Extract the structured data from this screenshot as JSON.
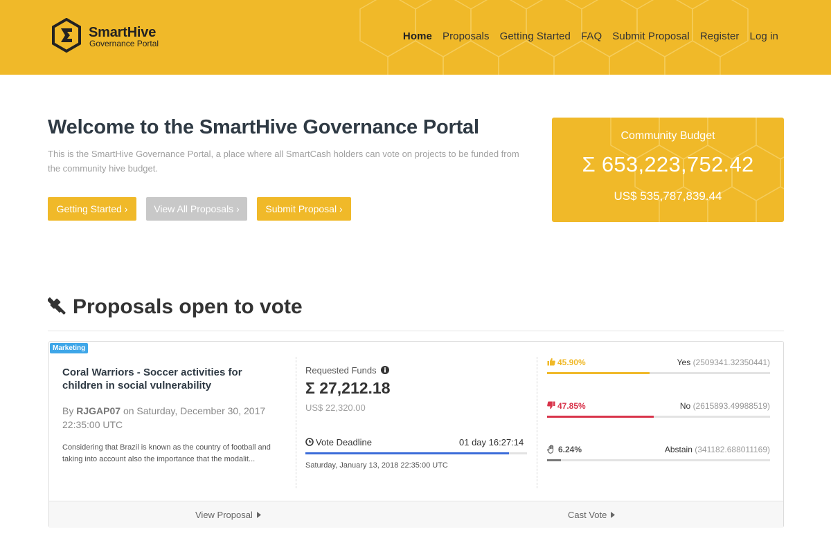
{
  "brand": {
    "name": "SmartHive",
    "subtitle": "Governance Portal",
    "color": "#f0b929"
  },
  "nav": {
    "items": [
      {
        "label": "Home",
        "active": true
      },
      {
        "label": "Proposals"
      },
      {
        "label": "Getting Started"
      },
      {
        "label": "FAQ"
      },
      {
        "label": "Submit Proposal"
      },
      {
        "label": "Register"
      },
      {
        "label": "Log in"
      }
    ]
  },
  "hero": {
    "title": "Welcome to the SmartHive Governance Portal",
    "description": "This is the SmartHive Governance Portal, a place where all SmartCash holders can vote on projects to be funded from the community hive budget.",
    "buttons": {
      "getting_started": "Getting Started ›",
      "view_all": "View All Proposals ›",
      "submit": "Submit Proposal ›"
    }
  },
  "budget": {
    "label": "Community Budget",
    "amount": "Σ 653,223,752.42",
    "usd": "US$ 535,787,839.44"
  },
  "section": {
    "title": "Proposals open to vote",
    "icon": "gavel-icon"
  },
  "proposal": {
    "badge": "Marketing",
    "badge_color": "#3ea6e8",
    "title": "Coral Warriors - Soccer activities for children in social vulnerability",
    "by_prefix": "By",
    "author": "RJGAP07",
    "date_text": "on Saturday, December 30, 2017 22:35:00 UTC",
    "description": "Considering that Brazil is known as the country of football and taking into account also the importance that the modalit...",
    "requested_label": "Requested Funds",
    "requested_value": "Σ 27,212.18",
    "requested_usd": "US$ 22,320.00",
    "deadline_label": "Vote Deadline",
    "deadline_remaining": "01 day 16:27:14",
    "deadline_date": "Saturday, January 13, 2018 22:35:00 UTC",
    "deadline_progress": 0.92,
    "votes": {
      "yes": {
        "pct": "45.90%",
        "label": "Yes",
        "count": "(2509341.32350441)",
        "fraction": 0.459,
        "color": "#f0b929"
      },
      "no": {
        "pct": "47.85%",
        "label": "No",
        "count": "(2615893.49988519)",
        "fraction": 0.4785,
        "color": "#d8334a"
      },
      "abstain": {
        "pct": "6.24%",
        "label": "Abstain",
        "count": "(341182.688011169)",
        "fraction": 0.0624,
        "color": "#777777"
      }
    },
    "footer": {
      "view": "View Proposal",
      "vote": "Cast Vote"
    }
  }
}
